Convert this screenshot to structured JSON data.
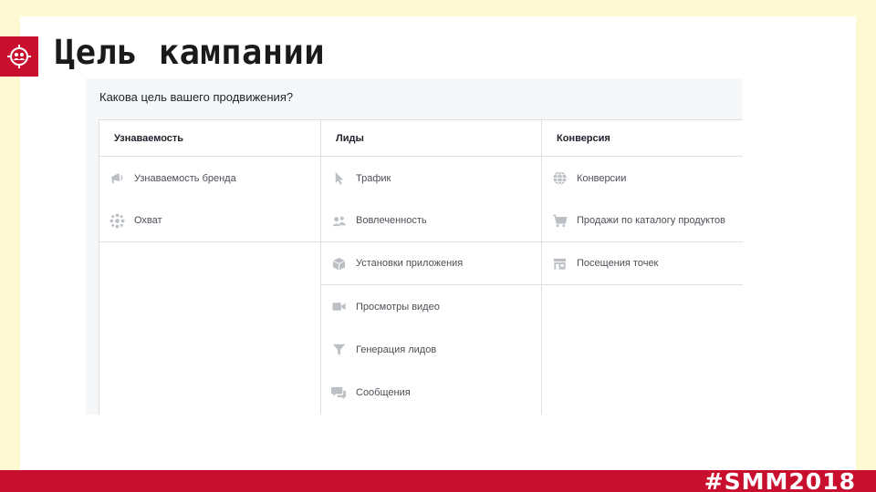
{
  "slide": {
    "title": "Цель кампании",
    "hashtag": "#SMM2018"
  },
  "colors": {
    "background": "#fdf9d2",
    "accent": "#c8102e",
    "icon_gray": "#bcc0c4"
  },
  "objective_picker": {
    "question": "Какова цель вашего продвижения?",
    "columns": [
      {
        "header": "Узнаваемость",
        "items": [
          {
            "label": "Узнаваемость бренда",
            "icon": "megaphone-icon"
          },
          {
            "label": "Охват",
            "icon": "reach-icon"
          }
        ]
      },
      {
        "header": "Лиды",
        "items": [
          {
            "label": "Трафик",
            "icon": "cursor-icon"
          },
          {
            "label": "Вовлеченность",
            "icon": "people-icon"
          },
          {
            "label": "Установки приложения",
            "icon": "box-icon"
          },
          {
            "label": "Просмотры видео",
            "icon": "video-camera-icon"
          },
          {
            "label": "Генерация лидов",
            "icon": "funnel-icon"
          },
          {
            "label": "Сообщения",
            "icon": "chat-bubbles-icon"
          }
        ]
      },
      {
        "header": "Конверсия",
        "items": [
          {
            "label": "Конверсии",
            "icon": "globe-icon"
          },
          {
            "label": "Продажи по каталогу продуктов",
            "icon": "cart-icon"
          },
          {
            "label": "Посещения точек",
            "icon": "store-icon"
          }
        ]
      }
    ]
  }
}
